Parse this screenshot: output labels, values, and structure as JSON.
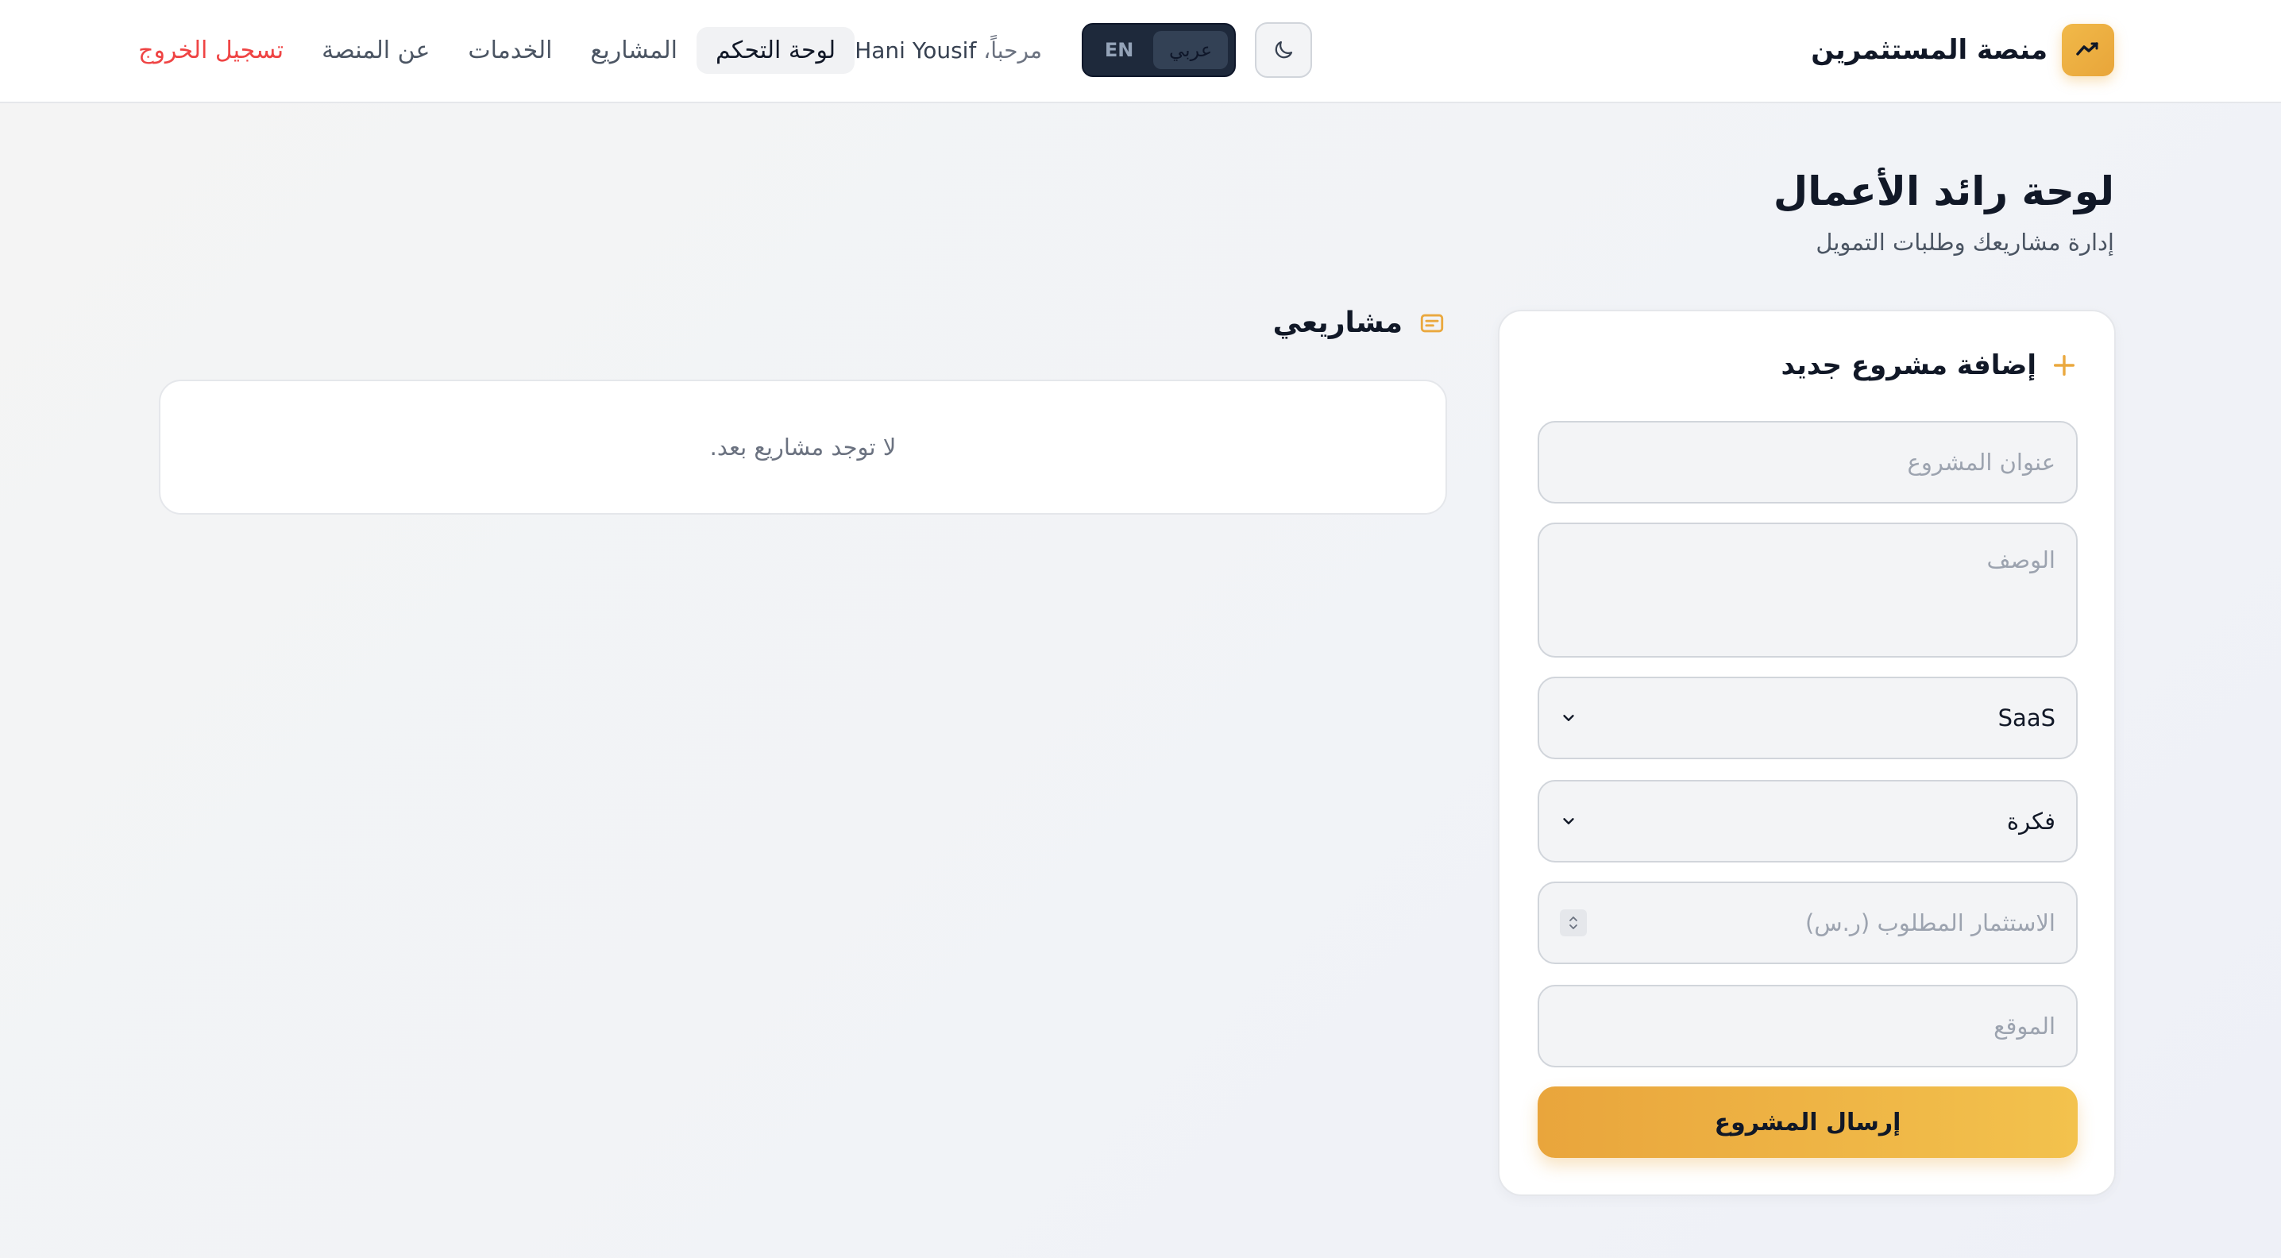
{
  "header": {
    "brand_name": "منصة المستثمرين",
    "welcome_prefix": "مرحباً،",
    "user_name": "Hani Yousif",
    "lang_options": [
      "عربي",
      "EN"
    ],
    "nav": [
      {
        "label": "لوحة التحكم",
        "active": true
      },
      {
        "label": "المشاريع",
        "active": false
      },
      {
        "label": "الخدمات",
        "active": false
      },
      {
        "label": "عن المنصة",
        "active": false
      },
      {
        "label": "تسجيل الخروج",
        "active": false
      }
    ]
  },
  "page": {
    "title": "لوحة رائد الأعمال",
    "subtitle": "إدارة مشاريعك وطلبات التمويل"
  },
  "form": {
    "title": "إضافة مشروع جديد",
    "title_placeholder": "عنوان المشروع",
    "description_placeholder": "الوصف",
    "category_value": "SaaS",
    "stage_value": "فكرة",
    "investment_placeholder": "الاستثمار المطلوب (ر.س)",
    "location_placeholder": "الموقع",
    "submit_label": "إرسال المشروع"
  },
  "projects": {
    "title": "مشاريعي",
    "empty_message": "لا توجد مشاريع بعد."
  },
  "colors": {
    "accent": "#EAA83E",
    "danger": "#EF4444",
    "dark": "#1E293B"
  }
}
